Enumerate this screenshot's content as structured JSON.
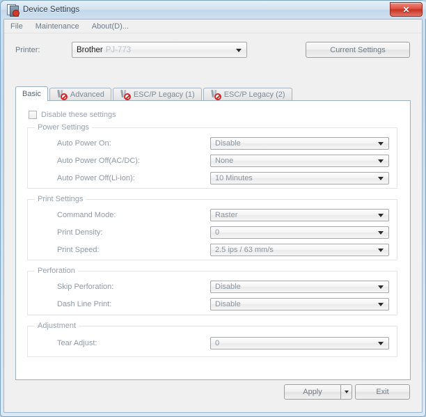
{
  "window": {
    "title": "Device Settings",
    "title_icon": "device-settings-icon",
    "close_label": "✕"
  },
  "menubar": {
    "items": [
      {
        "label": "File",
        "name": "menu-file"
      },
      {
        "label": "Maintenance",
        "name": "menu-maintenance"
      },
      {
        "label": "About(D)...",
        "name": "menu-about"
      }
    ]
  },
  "printer": {
    "label": "Printer:",
    "value": "Brother",
    "model": "PJ-773",
    "current_settings_label": "Current Settings"
  },
  "tabs": [
    {
      "label": "Basic",
      "active": true,
      "icon": null
    },
    {
      "label": "Advanced",
      "active": false,
      "icon": "wrench-disabled-icon"
    },
    {
      "label": "ESC/P Legacy (1)",
      "active": false,
      "icon": "wrench-disabled-icon"
    },
    {
      "label": "ESC/P Legacy (2)",
      "active": false,
      "icon": "wrench-disabled-icon"
    }
  ],
  "panel": {
    "disable_checkbox_label": "Disable these settings",
    "disable_checkbox_checked": false,
    "groups": [
      {
        "title": "Power Settings",
        "fields": [
          {
            "label": "Auto Power On:",
            "value": "Disable"
          },
          {
            "label": "Auto Power Off(AC/DC):",
            "value": "None"
          },
          {
            "label": "Auto Power Off(Li-ion):",
            "value": "10 Minutes"
          }
        ]
      },
      {
        "title": "Print Settings",
        "fields": [
          {
            "label": "Command Mode:",
            "value": "Raster"
          },
          {
            "label": "Print Density:",
            "value": "0"
          },
          {
            "label": "Print Speed:",
            "value": "2.5 ips / 63 mm/s"
          }
        ]
      },
      {
        "title": "Perforation",
        "fields": [
          {
            "label": "Skip Perforation:",
            "value": "Disable"
          },
          {
            "label": "Dash Line Print:",
            "value": "Disable"
          }
        ]
      },
      {
        "title": "Adjustment",
        "fields": [
          {
            "label": "Tear Adjust:",
            "value": "0"
          }
        ]
      }
    ]
  },
  "footer": {
    "apply_label": "Apply",
    "apply_dropdown_icon": "chevron-down-icon",
    "exit_label": "Exit"
  },
  "colors": {
    "frame": "#b5cfe3",
    "close_button": "#c93124",
    "tab_active_bg": "#ffffff",
    "panel_bg": "#ffffff"
  }
}
